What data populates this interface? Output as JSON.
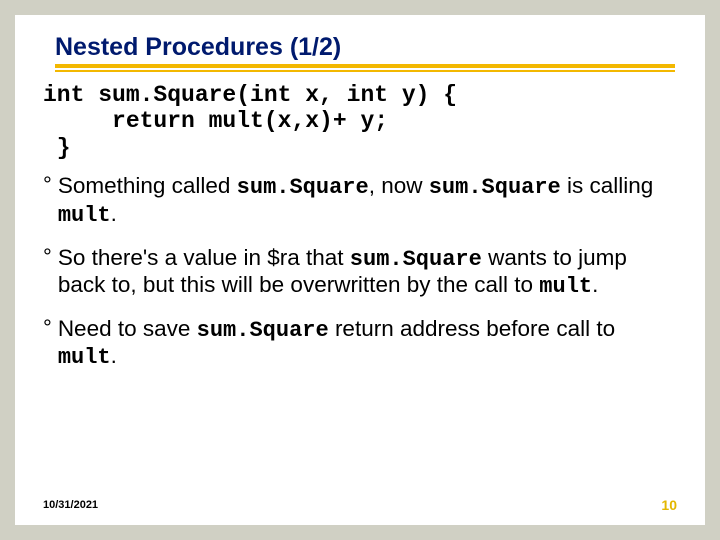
{
  "title": "Nested Procedures (1/2)",
  "code_line1": "int sum.Square(int x, int y) {",
  "code_line2": "     return mult(x,x)+ y;",
  "code_line3": " }",
  "b1_pre": "Something called ",
  "b1_m1": "sum.Square",
  "b1_mid": ", now ",
  "b1_m2": "sum.Square",
  "b1_mid2": " is calling ",
  "b1_m3": "mult",
  "b1_post": ".",
  "b2_pre": "So there's a value in $ra that ",
  "b2_m1": "sum.Square",
  "b2_mid": " wants to jump back to, but this will be overwritten by the call to ",
  "b2_m2": "mult",
  "b2_post": ".",
  "b3_pre": "Need to save ",
  "b3_m1": "sum.Square",
  "b3_mid": " return address before call to ",
  "b3_m2": "mult",
  "b3_post": ".",
  "date": "10/31/2021",
  "pagenum": "10",
  "deg": "°"
}
